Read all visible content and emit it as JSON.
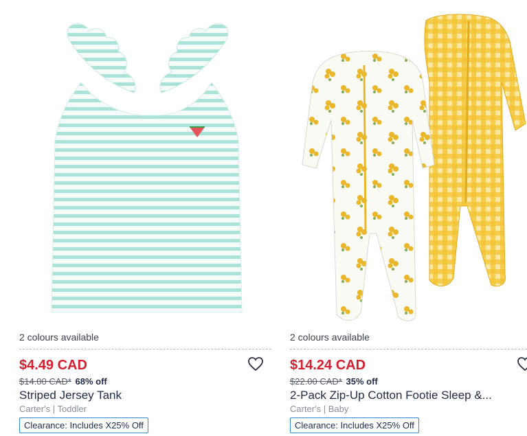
{
  "products": [
    {
      "image_alt": "Striped Jersey Tank",
      "colours": "2 colours available",
      "price": "$4.49 CAD",
      "was_price": "$14.00 CAD*",
      "discount": "68% off",
      "title": "Striped Jersey Tank",
      "brand": "Carter's | Toddler",
      "badge": "Clearance: Includes X25% Off",
      "wishlist_icon": "heart-outline-icon",
      "colors": {
        "stripe": "#a9e3d8",
        "base": "#f2fbf8"
      }
    },
    {
      "image_alt": "2-Pack Zip-Up Cotton Footie Sleep & Play",
      "colours": "2 colours available",
      "price": "$14.24 CAD",
      "was_price": "$22.00 CAD*",
      "discount": "35% off",
      "title": "2-Pack Zip-Up Cotton Footie Sleep &...",
      "brand": "Carter's | Baby",
      "badge": "Clearance: Includes X25% Off",
      "wishlist_icon": "heart-outline-icon",
      "colors": {
        "gingham": "#f2c230",
        "floral": "#eab62a"
      }
    }
  ],
  "theme": {
    "sale_red": "#d41f2f",
    "badge_border": "#2d8ad3"
  }
}
